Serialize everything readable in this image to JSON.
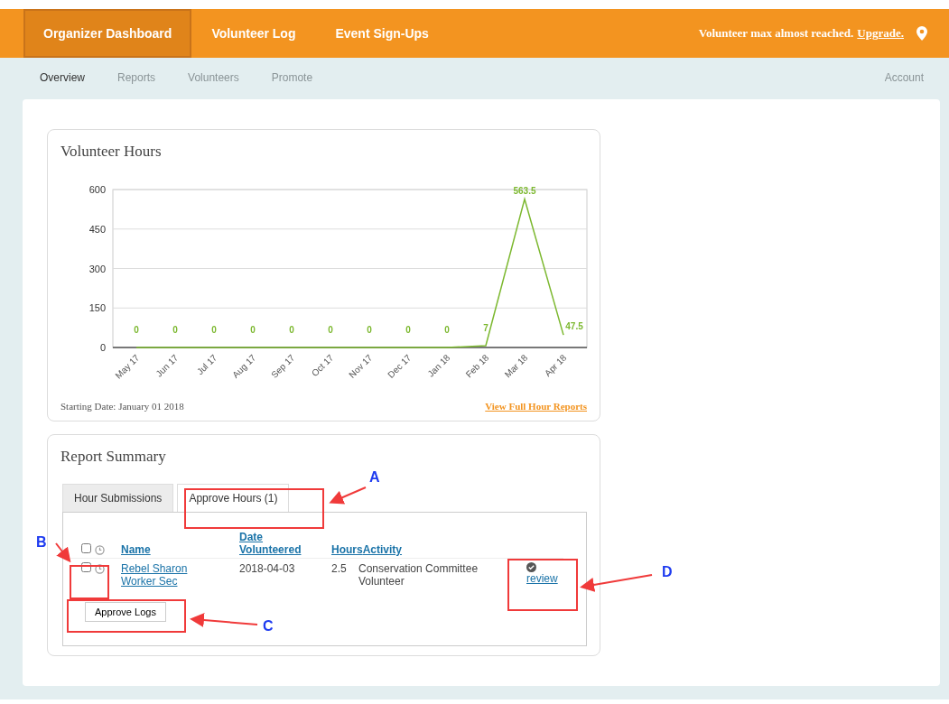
{
  "top_nav": {
    "items": [
      {
        "label": "Organizer Dashboard",
        "selected": true
      },
      {
        "label": "Volunteer Log",
        "selected": false
      },
      {
        "label": "Event Sign-Ups",
        "selected": false
      }
    ],
    "notice": "Volunteer max almost reached.",
    "upgrade_link": "Upgrade."
  },
  "sub_nav": {
    "items": [
      {
        "label": "Overview",
        "selected": true
      },
      {
        "label": "Reports",
        "selected": false
      },
      {
        "label": "Volunteers",
        "selected": false
      },
      {
        "label": "Promote",
        "selected": false
      }
    ],
    "account": "Account"
  },
  "hours_card": {
    "title": "Volunteer Hours",
    "chart_data": {
      "type": "line",
      "categories": [
        "May 17",
        "Jun 17",
        "Jul 17",
        "Aug 17",
        "Sep 17",
        "Oct 17",
        "Nov 17",
        "Dec 17",
        "Jan 18",
        "Feb 18",
        "Mar 18",
        "Apr 18"
      ],
      "series": [
        {
          "color": "#7cb82f",
          "values": [
            0,
            0,
            0,
            0,
            0,
            0,
            0,
            0,
            0,
            7,
            563.5,
            47.5
          ]
        }
      ],
      "ylim": [
        0,
        600
      ],
      "yticks": [
        0,
        150,
        300,
        450,
        600
      ],
      "data_labels": true,
      "grid": true
    },
    "starting_date": "Starting Date: January 01 2018",
    "report_link": "View Full Hour Reports"
  },
  "report_card": {
    "title": "Report Summary",
    "tabs": [
      {
        "label": "Hour Submissions",
        "selected": false
      },
      {
        "label": "Approve Hours (1)",
        "selected": true
      }
    ],
    "select_all_checked": false,
    "columns": [
      "Name",
      "Date Volunteered",
      "Hours",
      "Activity"
    ],
    "rows": [
      {
        "checked": false,
        "name": "Rebel Sharon Worker Sec",
        "date": "2018-04-03",
        "hours": "2.5",
        "activity": "Conservation Committee Volunteer",
        "action": "review"
      }
    ],
    "approve_button": "Approve Logs"
  },
  "annotations": [
    {
      "label": "A"
    },
    {
      "label": "B"
    },
    {
      "label": "C"
    },
    {
      "label": "D"
    }
  ]
}
